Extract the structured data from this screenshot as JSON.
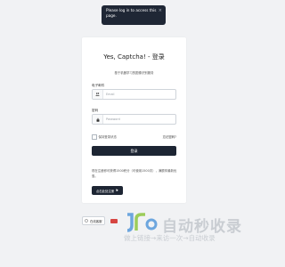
{
  "toast": {
    "message": "Please log in to access this page.",
    "close": "×"
  },
  "login": {
    "title": "Yes, Captcha! - 登录",
    "subtitle": "基于机器学习的图像识别服务",
    "email_label": "电子邮件",
    "email_placeholder": "Email",
    "password_label": "密码",
    "password_placeholder": "Password",
    "remember_label": "保持登录状态",
    "forgot_label": "忘记密码?",
    "submit_label": "登录",
    "register_text": "现在注册即可获得1500积分（可使用1500次），满额享最新优惠。",
    "register_text_tail": "最优惠。",
    "register_button": "点击此处注册"
  },
  "footer": {
    "feedback_label": "在线客服"
  },
  "watermark": {
    "title": "自动秒收录",
    "subtitle": "做上链接→来访一次→自动收录"
  },
  "colors": {
    "primary": "#1d2533",
    "toast_bg": "#1f2735",
    "page_bg": "#f1f2f4"
  }
}
